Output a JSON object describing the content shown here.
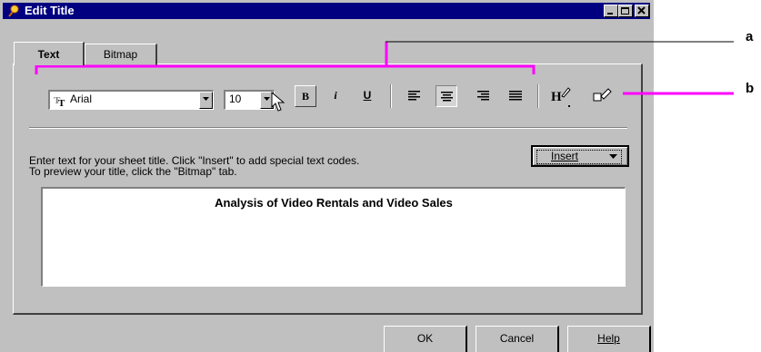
{
  "window": {
    "title": "Edit Title"
  },
  "tabs": [
    {
      "label": "Text"
    },
    {
      "label": "Bitmap"
    }
  ],
  "toolbar": {
    "font_name": "Arial",
    "font_size": "10",
    "bold_label": "B",
    "italic_label": "i",
    "underline_label": "U"
  },
  "instructions": {
    "line1": "Enter text for your sheet title. Click \"Insert\" to add special text codes.",
    "line2": "To preview your title, click the \"Bitmap\" tab."
  },
  "insert_label": "Insert",
  "title_text": "Analysis of Video Rentals and Video Sales",
  "footer": {
    "ok_label": "OK",
    "cancel_label": "Cancel",
    "help_label": "Help"
  },
  "callouts": {
    "a": "a",
    "b": "b"
  },
  "colors": {
    "titlebar": "#000080",
    "callout_line": "#ff00ff",
    "dialog": "#c0c0c0"
  }
}
